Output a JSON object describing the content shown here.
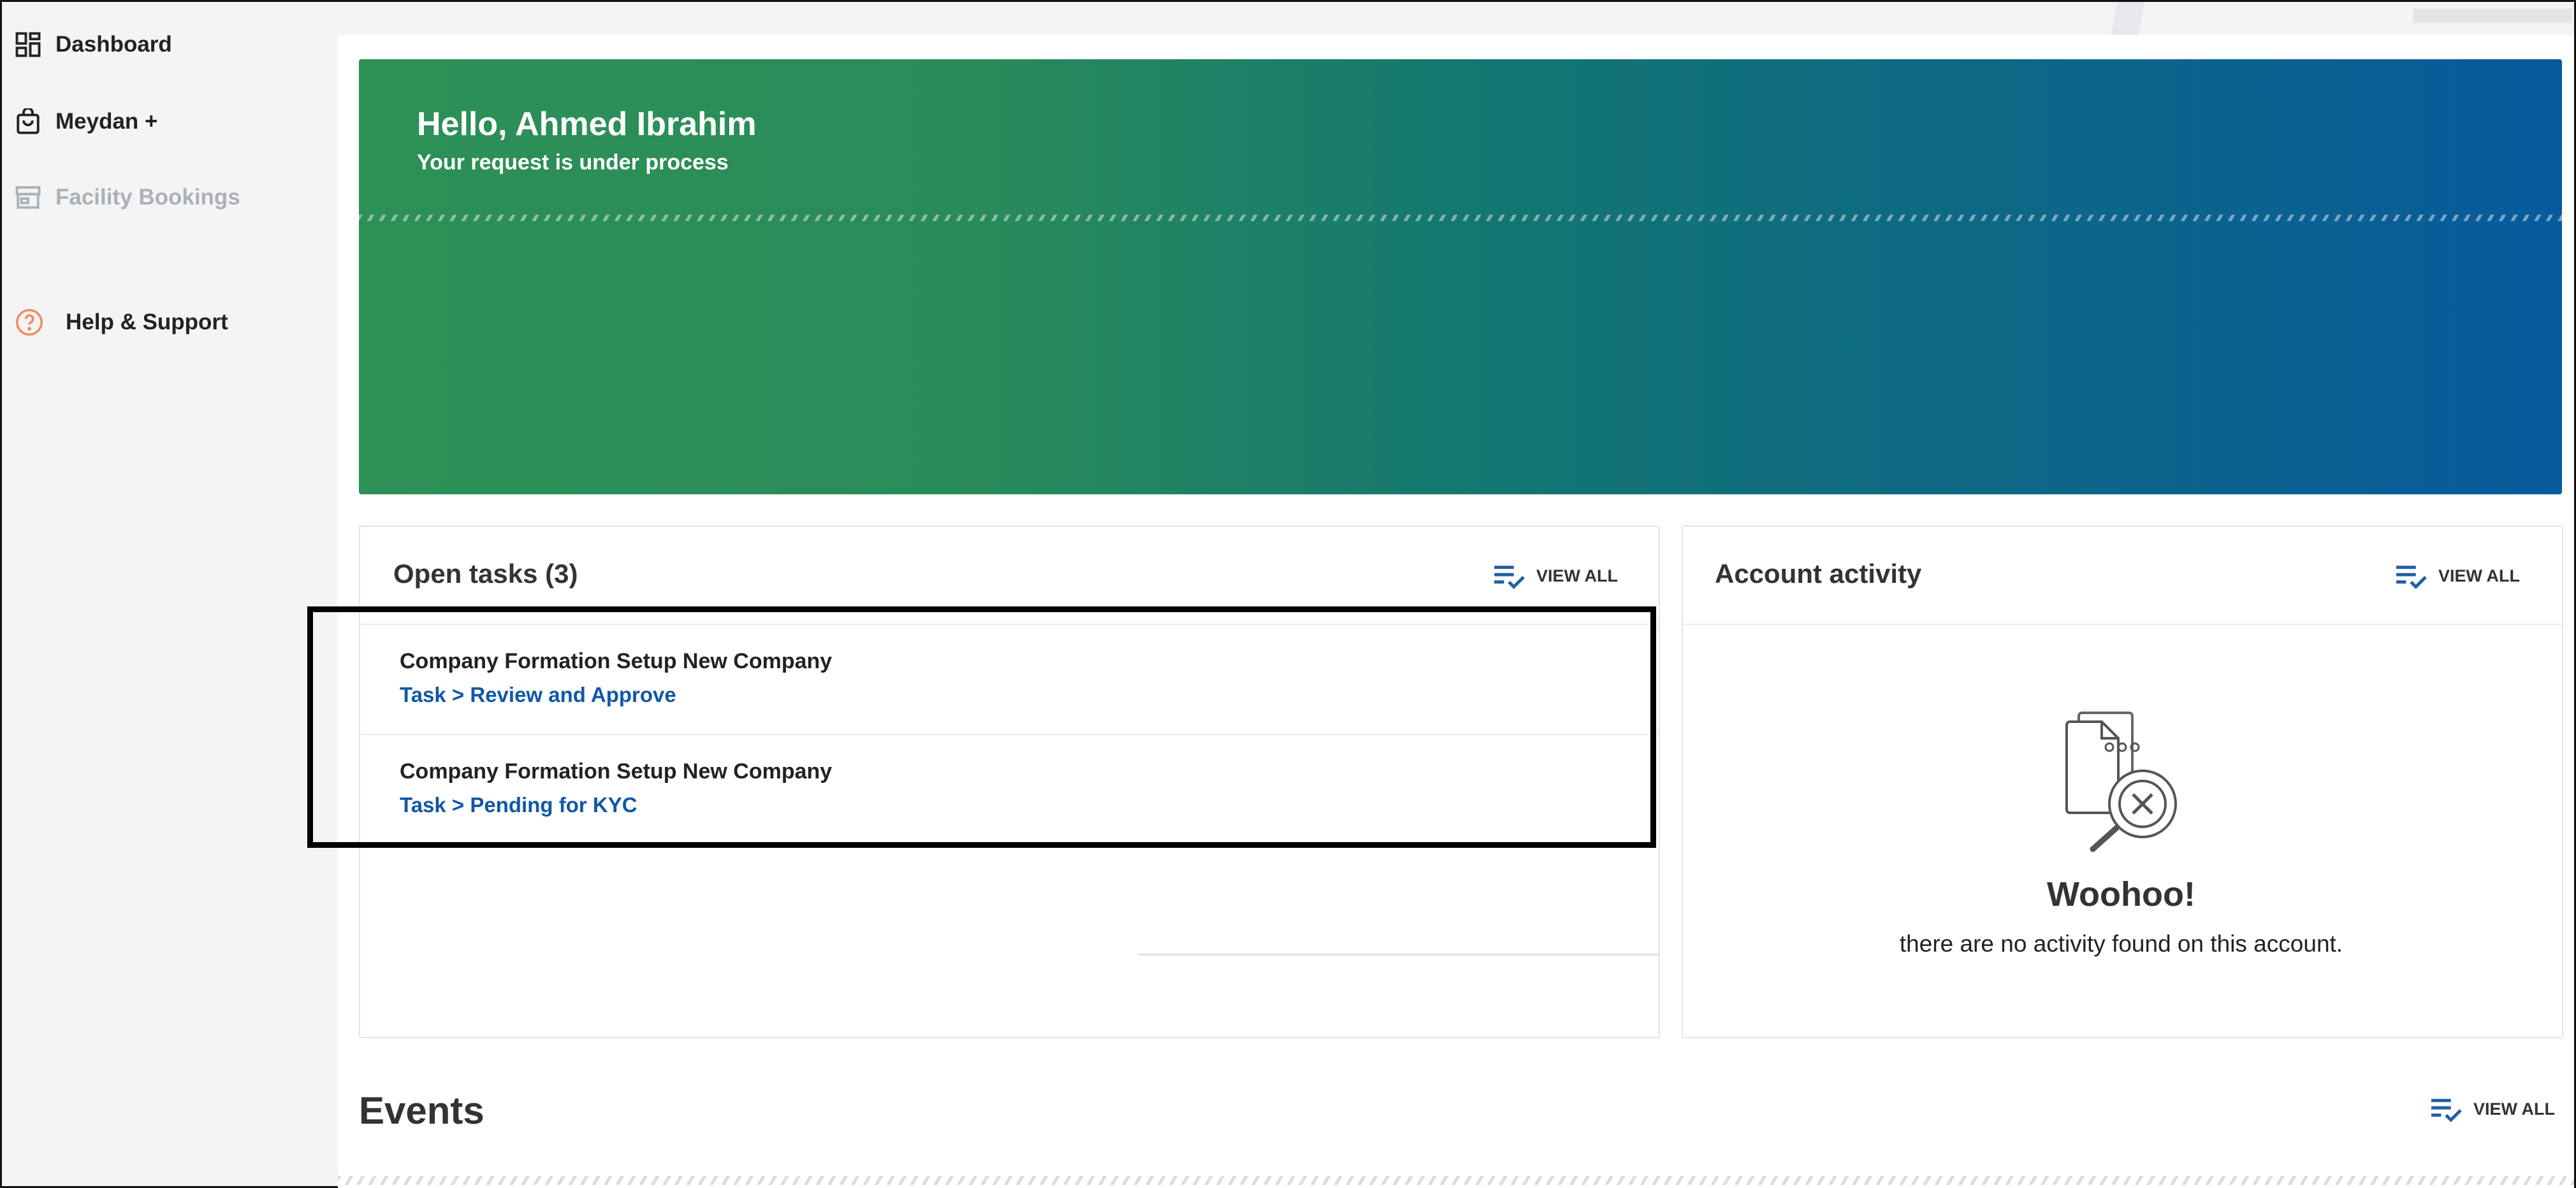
{
  "sidebar": {
    "items": [
      {
        "label": "Dashboard",
        "icon": "dashboard-grid-icon"
      },
      {
        "label": "Meydan +",
        "icon": "shopping-bag-icon"
      },
      {
        "label": "Facility Bookings",
        "icon": "storefront-icon"
      },
      {
        "label": "Help & Support",
        "icon": "help-circle-icon"
      }
    ]
  },
  "hero": {
    "greeting": "Hello, Ahmed Ibrahim",
    "subtitle": "Your request is under process"
  },
  "open_tasks": {
    "title": "Open tasks (3)",
    "view_all": "VIEW ALL",
    "tasks": [
      {
        "title": "Company Formation Setup New Company",
        "link": "Task > Review and Approve"
      },
      {
        "title": "Company Formation Setup New Company",
        "link": "Task > Pending for KYC"
      }
    ]
  },
  "account_activity": {
    "title": "Account activity",
    "view_all": "VIEW ALL",
    "empty_title": "Woohoo!",
    "empty_text": "there are no activity found on this account."
  },
  "events": {
    "title": "Events",
    "view_all": "VIEW ALL"
  },
  "colors": {
    "hero_start": "#2d9056",
    "hero_end": "#085a9c",
    "link": "#1058a6",
    "help_icon": "#f08a5d",
    "accent_icon": "#1f5fa8"
  }
}
